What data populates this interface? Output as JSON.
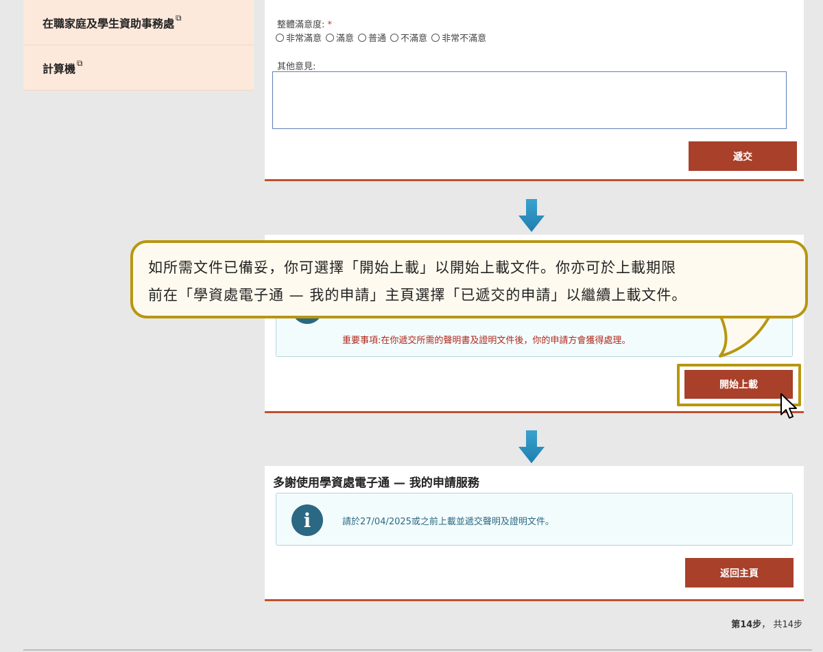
{
  "sidebar": {
    "items": [
      {
        "label": "在職家庭及學生資助事務處"
      },
      {
        "label": "計算機"
      }
    ]
  },
  "survey": {
    "rating_label": "整體滿意度:",
    "required_mark": "*",
    "options": [
      "非常滿意",
      "滿意",
      "普通",
      "不滿意",
      "非常不滿意"
    ],
    "comment_label": "其他意見:",
    "submit_label": "遞交"
  },
  "upload": {
    "important_notice": "重要事項:在你遞交所需的聲明書及證明文件後，你的申請方會獲得處理。",
    "start_upload_label": "開始上載"
  },
  "callout": {
    "line1": "如所需文件已備妥，你可選擇「開始上載」以開始上載文件。你亦可於上載期限",
    "line2": "前在「學資處電子通 — 我的申請」主頁選擇「已遞交的申請」以繼續上載文件。"
  },
  "thanks": {
    "title": "多謝使用學資處電子通 — 我的申請服務",
    "notice": "請於27/04/2025或之前上載並遞交聲明及證明文件。",
    "home_label": "返回主頁"
  },
  "steps": {
    "current": "第14步",
    "separator": "，",
    "total": "共14步"
  },
  "colors": {
    "accent": "#a8402a",
    "highlight": "#b8960f",
    "info": "#2b6883",
    "sidebar_bg": "#fde9dc"
  }
}
